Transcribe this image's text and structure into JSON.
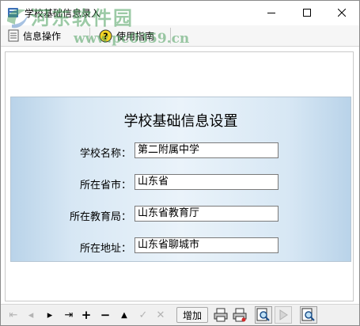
{
  "window": {
    "title": "学校基础信息录入"
  },
  "watermark": {
    "line1": "河东软件园",
    "line2": "www.pc0359.cn"
  },
  "menu": {
    "items": [
      {
        "label": "信息操作",
        "icon": "database-icon"
      },
      {
        "label": "使用指南",
        "icon": "help-icon"
      }
    ]
  },
  "form": {
    "title": "学校基础信息设置",
    "fields": [
      {
        "label": "学校名称：",
        "value": "第二附属中学"
      },
      {
        "label": "所在省市：",
        "value": "山东省"
      },
      {
        "label": "所在教育局：",
        "value": "山东省教育厅"
      },
      {
        "label": "所在地址：",
        "value": "山东省聊城市"
      }
    ]
  },
  "navigator": {
    "first": "⇤",
    "prior": "◂",
    "next": "▸",
    "last": "⇥",
    "insert": "+",
    "delete": "−",
    "edit": "▲",
    "post": "✓",
    "cancel": "✕",
    "add_label": "增加",
    "icons": [
      "print-icon",
      "print-preview-icon",
      "search-icon",
      "play-icon",
      "find-icon"
    ]
  },
  "colors": {
    "panel_gradient_edge": "#b9d3e9",
    "panel_gradient_center": "#eaf3fa",
    "watermark": "#4a9e5c"
  }
}
